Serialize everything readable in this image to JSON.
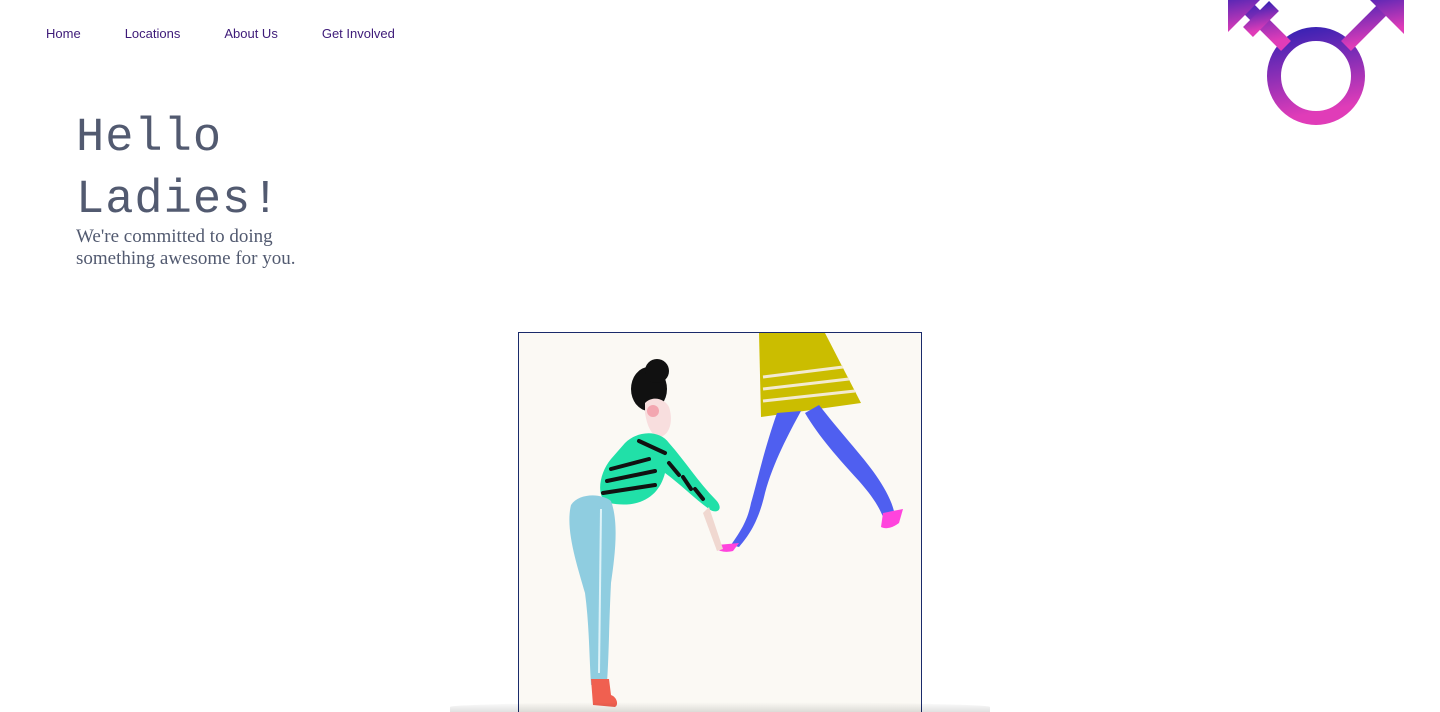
{
  "nav": {
    "items": [
      {
        "label": "Home"
      },
      {
        "label": "Locations"
      },
      {
        "label": "About Us"
      },
      {
        "label": "Get Involved"
      }
    ]
  },
  "hero": {
    "title_line1": "Hello",
    "title_line2": "Ladies!",
    "subtitle": "We're committed to doing something awesome for you."
  },
  "logo": {
    "icon": "transgender-symbol-icon",
    "gradient_top": "#3a22b4",
    "gradient_bottom": "#e03cb8"
  },
  "illustration": {
    "icon": "two-women-illustration",
    "background": "#fbf9f4",
    "border": "#1a2a6a"
  },
  "colors": {
    "nav_link": "#3d1a78",
    "heading": "#525a70"
  }
}
